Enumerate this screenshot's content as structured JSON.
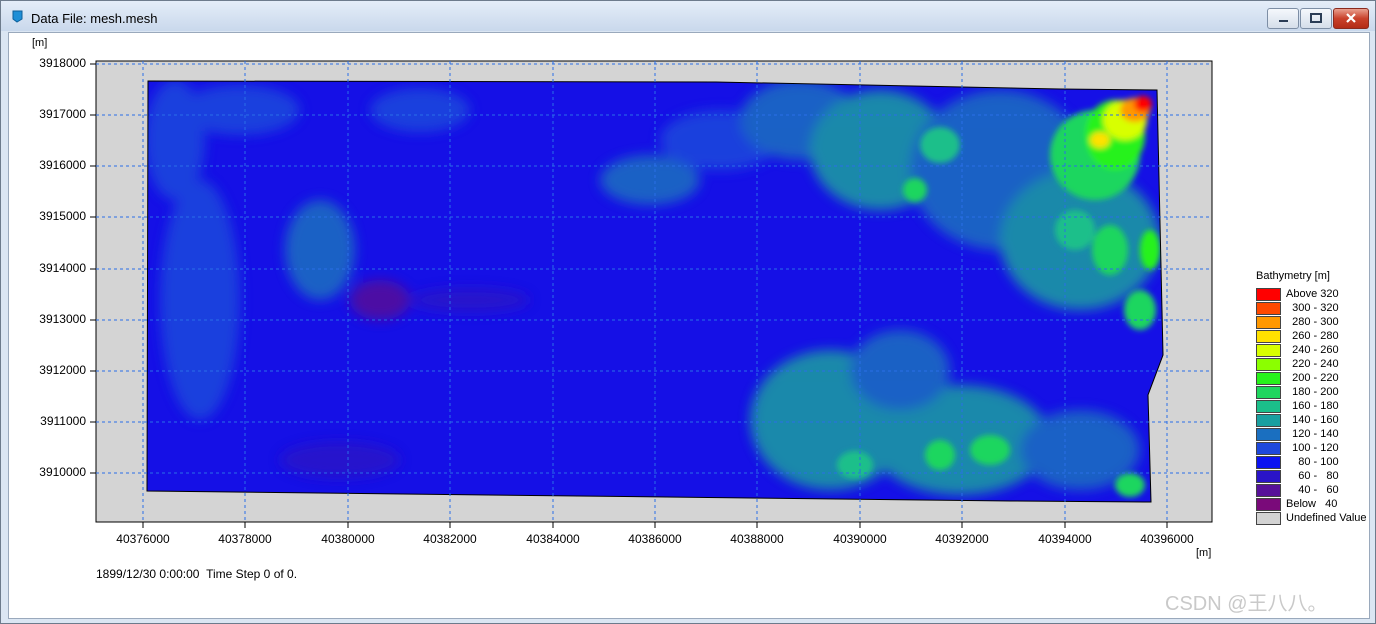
{
  "window": {
    "title": "Data File: mesh.mesh",
    "app_icon": "app-icon"
  },
  "axes": {
    "y_unit": "[m]",
    "x_unit": "[m]",
    "y_ticks": [
      "3918000",
      "3917000",
      "3916000",
      "3915000",
      "3914000",
      "3913000",
      "3912000",
      "3911000",
      "3910000"
    ],
    "x_ticks": [
      "40376000",
      "40378000",
      "40380000",
      "40382000",
      "40384000",
      "40386000",
      "40388000",
      "40390000",
      "40392000",
      "40394000",
      "40396000"
    ]
  },
  "status": {
    "time": "1899/12/30 0:00:00",
    "step": "Time Step 0 of 0."
  },
  "legend": {
    "title": "Bathymetry [m]",
    "items": [
      {
        "label": "Above 320",
        "color": "#ff0000"
      },
      {
        "label": "  300 - 320",
        "color": "#ff4a00"
      },
      {
        "label": "  280 - 300",
        "color": "#ff9800"
      },
      {
        "label": "  260 - 280",
        "color": "#ffe100"
      },
      {
        "label": "  240 - 260",
        "color": "#d8ff00"
      },
      {
        "label": "  220 - 240",
        "color": "#8bff00"
      },
      {
        "label": "  200 - 220",
        "color": "#27f21b"
      },
      {
        "label": "  180 - 200",
        "color": "#1fd65e"
      },
      {
        "label": "  160 - 180",
        "color": "#1bbf8a"
      },
      {
        "label": "  140 - 160",
        "color": "#1a9fa0"
      },
      {
        "label": "  120 - 140",
        "color": "#1a6fc0"
      },
      {
        "label": "  100 - 120",
        "color": "#1e48dc"
      },
      {
        "label": "    80 - 100",
        "color": "#0b12f0"
      },
      {
        "label": "    60 -   80",
        "color": "#2a14c8"
      },
      {
        "label": "    40 -   60",
        "color": "#571199"
      },
      {
        "label": "Below   40",
        "color": "#7a0a7a"
      },
      {
        "label": "Undefined Value",
        "color": "#d3d3d3"
      }
    ]
  },
  "watermark": "CSDN @王八八。"
}
